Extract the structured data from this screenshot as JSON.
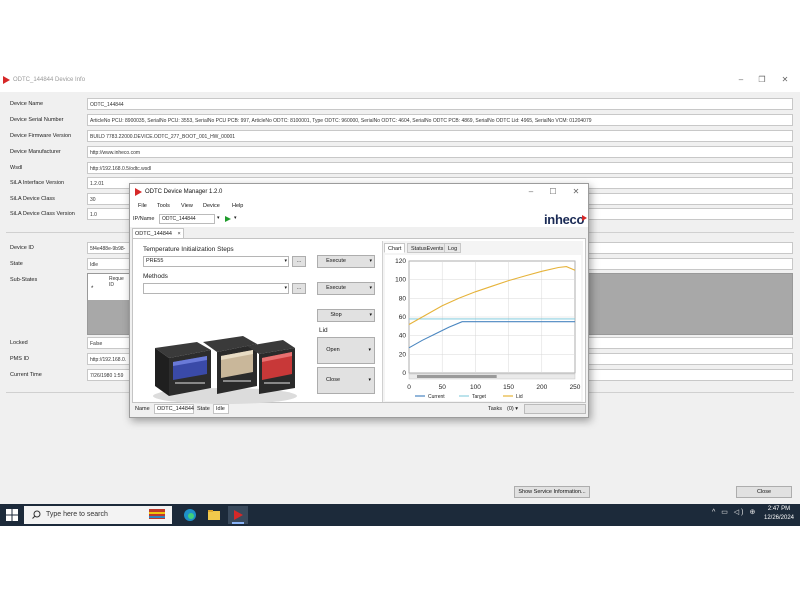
{
  "info_window": {
    "title": "ODTC_144844 Device Info",
    "properties": [
      {
        "label": "Device Name",
        "value": "ODTC_144844"
      },
      {
        "label": "Device Serial Number",
        "value": "ArticleNo PCU: 8900035, SerialNo PCU: 3553, SerialNo PCU PCB: 997, ArticleNo ODTC: 8100001, Type ODTC: 960000, SerialNo ODTC: 4604, SerialNo ODTC PCB: 4869, SerialNo ODTC Lid: 4965, SerialNo VCM: 01204079"
      },
      {
        "label": "Device Firmware Version",
        "value": "BUILD 7783.22000.DEVICE.ODTC_277_BOOT_001_HW_00001"
      },
      {
        "label": "Device Manufacturer",
        "value": "http://www.inheco.com"
      },
      {
        "label": "Wsdl",
        "value": "http://192.168.0.5/odtc.wsdl"
      },
      {
        "label": "SiLA Interface Version",
        "value": "1.2.01"
      },
      {
        "label": "SiLA Device Class",
        "value": "30"
      },
      {
        "label": "SiLA Device Class Version",
        "value": "1.0"
      }
    ],
    "state_properties": [
      {
        "label": "Device ID",
        "value": "5f4e488e-9b98-"
      },
      {
        "label": "State",
        "value": "Idle"
      },
      {
        "label": "Sub-States",
        "value": ""
      }
    ],
    "substates_col": "Reque ID",
    "substates_marker": "*",
    "bottom_properties": [
      {
        "label": "Locked",
        "value": "False"
      },
      {
        "label": "PMS ID",
        "value": "http://192.168.0."
      },
      {
        "label": "Current Time",
        "value": "7/26/1980 1:59"
      }
    ],
    "service_button": "Show Service Information...",
    "close_button": "Close"
  },
  "manager": {
    "title": "ODTC Device Manager 1.2.0",
    "menu": [
      "File",
      "Tools",
      "View",
      "Device",
      "Help"
    ],
    "ip_label": "IP/Name",
    "ip_value": "ODTC_144844",
    "brand": "inheco",
    "doc_tab": "ODTC_144844",
    "doc_tab_close": "×",
    "temp_init_label": "Temperature Initialization Steps",
    "temp_init_value": "PRE55",
    "methods_label": "Methods",
    "methods_value": "",
    "ellipsis": "...",
    "execute_label": "Execute",
    "stop_label": "Stop",
    "lid_label": "Lid",
    "open_label": "Open",
    "close_label": "Close",
    "chart_tabs": [
      "Chart",
      "StatusEvents",
      "Log"
    ],
    "status_name_label": "Name",
    "status_name_value": "ODTC_144844",
    "status_state_label": "State",
    "status_state_value": "Idle",
    "tasks_label": "Tasks",
    "tasks_value": "(0)"
  },
  "chart_data": {
    "type": "line",
    "xlim": [
      0,
      250
    ],
    "ylim": [
      0,
      120
    ],
    "x_ticks": [
      "0",
      "50",
      "100",
      "150",
      "200",
      "250"
    ],
    "y_ticks": [
      "0",
      "20",
      "40",
      "60",
      "80",
      "100",
      "120"
    ],
    "grid": true,
    "legend_position": "bottom",
    "series": [
      {
        "name": "Current",
        "color": "#4a86c0",
        "points": [
          [
            0,
            27
          ],
          [
            20,
            35
          ],
          [
            40,
            42
          ],
          [
            60,
            49
          ],
          [
            80,
            55
          ],
          [
            95,
            55
          ],
          [
            150,
            55
          ],
          [
            200,
            55
          ],
          [
            250,
            55
          ]
        ]
      },
      {
        "name": "Target",
        "color": "#8fd0e0",
        "points": [
          [
            0,
            58
          ],
          [
            95,
            58
          ],
          [
            150,
            58
          ],
          [
            200,
            58
          ],
          [
            250,
            58
          ]
        ]
      },
      {
        "name": "Lid",
        "color": "#e6b33a",
        "points": [
          [
            0,
            52
          ],
          [
            25,
            62
          ],
          [
            50,
            72
          ],
          [
            75,
            80
          ],
          [
            100,
            87
          ],
          [
            125,
            93
          ],
          [
            150,
            99
          ],
          [
            175,
            104
          ],
          [
            200,
            109
          ],
          [
            225,
            113
          ],
          [
            237,
            114
          ],
          [
            250,
            110
          ]
        ]
      }
    ]
  },
  "taskbar": {
    "search_placeholder": "Type here to search",
    "time": "2:47 PM",
    "date": "12/26/2024"
  }
}
